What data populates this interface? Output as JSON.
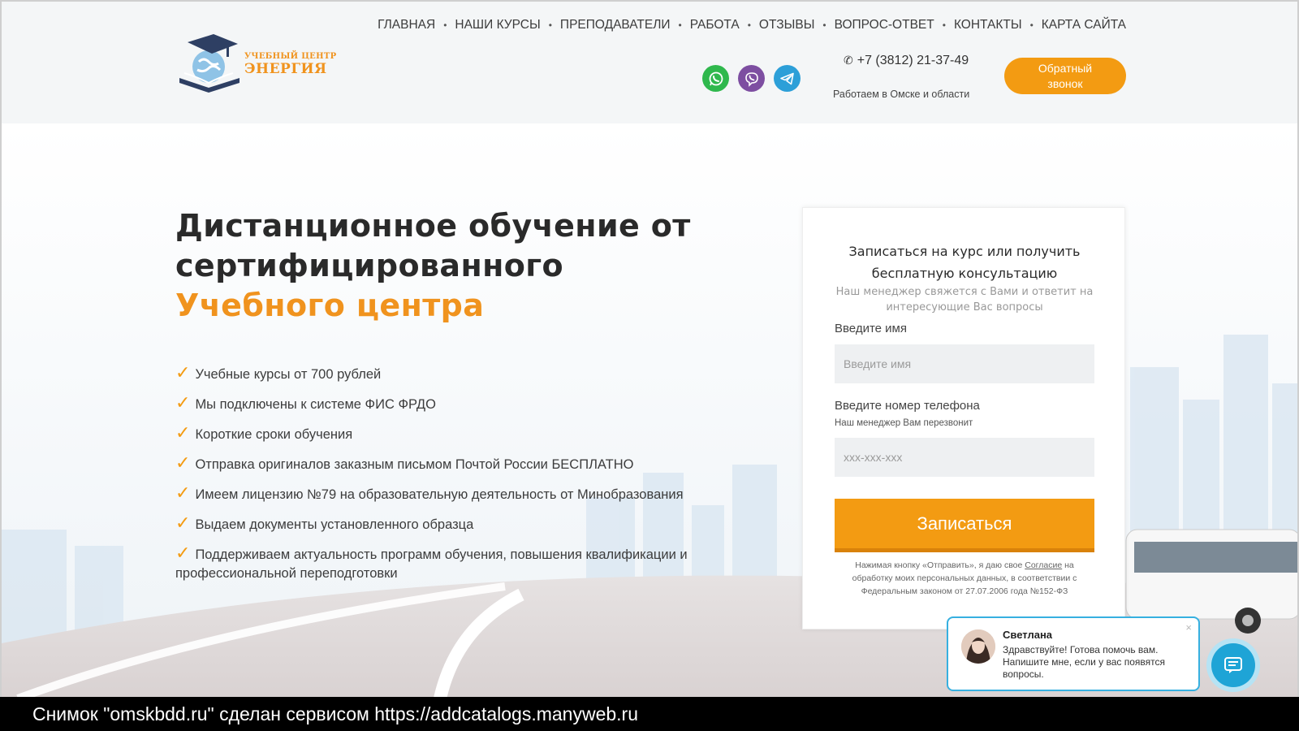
{
  "nav": {
    "items": [
      "ГЛАВНАЯ",
      "НАШИ КУРСЫ",
      "ПРЕПОДАВАТЕЛИ",
      "РАБОТА",
      "ОТЗЫВЫ",
      "ВОПРОС-ОТВЕТ",
      "КОНТАКТЫ",
      "КАРТА САЙТА"
    ],
    "separator": "•"
  },
  "logo": {
    "small": "УЧЕБНЫЙ ЦЕНТР",
    "big": "ЭНЕРГИЯ"
  },
  "messengers": [
    {
      "name": "whatsapp",
      "color": "#2fb84d"
    },
    {
      "name": "viber",
      "color": "#7d4ea1"
    },
    {
      "name": "telegram",
      "color": "#2c9fd8"
    }
  ],
  "contact": {
    "phone": "+7 (3812) 21-37-49",
    "work_area": "Работаем в Омске и области",
    "callback_label": "Обратный звонок"
  },
  "hero": {
    "title_line1": "Дистанционное обучение от",
    "title_line2": "сертифицированного",
    "title_accent": "Учебного центра",
    "features": [
      "Учебные курсы от 700 рублей",
      "Мы подключены к системе ФИС ФРДО",
      "Короткие сроки обучения",
      "Отправка оригиналов заказным письмом Почтой России БЕСПЛАТНО",
      "Имеем лицензию №79 на образовательную деятельность от Минобразования",
      "Выдаем документы установленного образца",
      "Поддерживаем актуальность программ обучения, повышения квалификации и профессиональной переподготовки"
    ]
  },
  "form": {
    "title": "Записаться на курс или получить бесплатную консультацию",
    "subtitle": "Наш менеджер свяжется с Вами и ответит на интересующие Вас вопросы",
    "name_label": "Введите имя",
    "name_placeholder": "Введите имя",
    "phone_label": "Введите номер телефона",
    "phone_hint": "Наш менеджер Вам перезвонит",
    "phone_placeholder": "xxx-xxx-xxx",
    "submit_label": "Записаться",
    "consent_before": "Нажимая кнопку «Отправить», я даю свое ",
    "consent_link": "Согласие",
    "consent_after": " на обработку моих персональных данных, в соответствии с Федеральным законом от 27.07.2006 года №152-ФЗ"
  },
  "chat": {
    "name": "Светлана",
    "message": "Здравствуйте! Готова помочь вам. Напишите мне, если у вас появятся вопросы.",
    "close": "×"
  },
  "caption": "Снимок \"omskbdd.ru\" сделан сервисом https://addcatalogs.manyweb.ru",
  "colors": {
    "accent": "#f39b12",
    "header_bg": "#f4f6f7",
    "chat_blue": "#1ea4d6"
  }
}
